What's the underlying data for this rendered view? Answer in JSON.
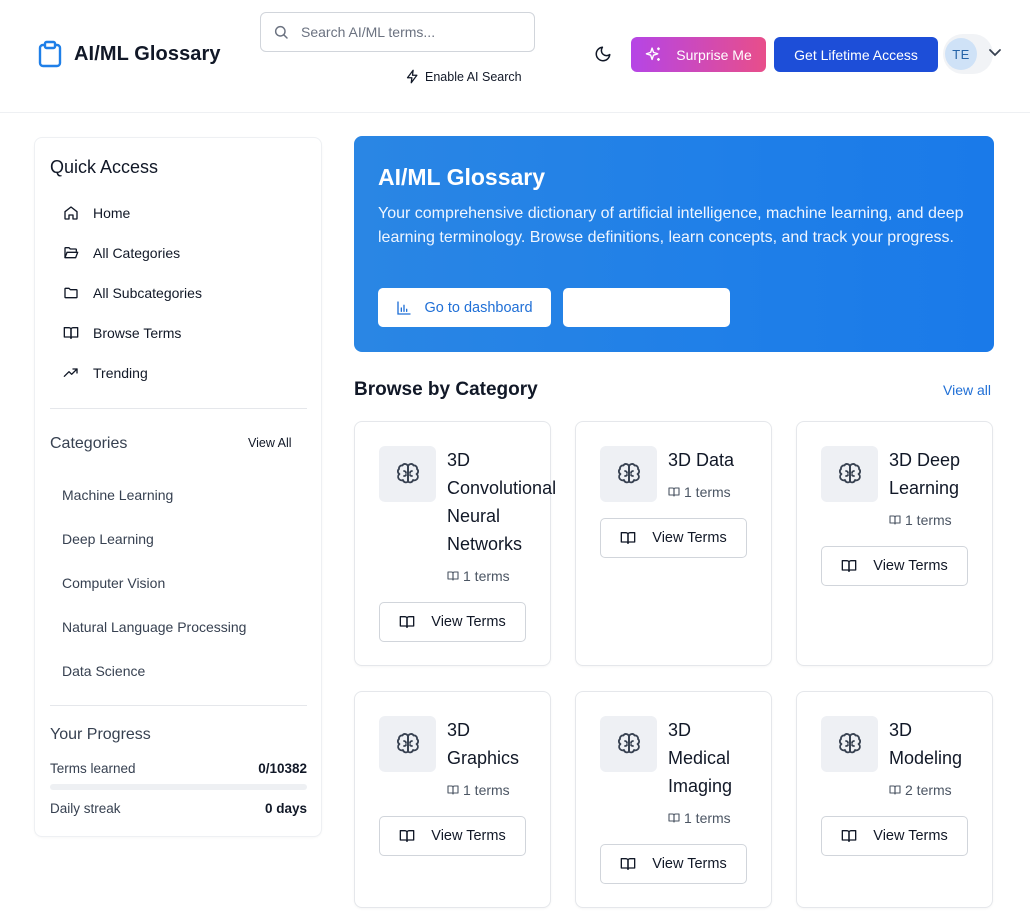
{
  "header": {
    "app_title": "AI/ML Glossary",
    "search_placeholder": "Search AI/ML terms...",
    "ai_search_label": "Enable AI Search",
    "surprise_label": "Surprise Me",
    "lifetime_label": "Get Lifetime Access",
    "avatar_initials": "TE"
  },
  "sidebar": {
    "quick_access_title": "Quick Access",
    "nav": [
      {
        "label": "Home",
        "icon": "home-icon"
      },
      {
        "label": "All Categories",
        "icon": "folder-open-icon"
      },
      {
        "label": "All Subcategories",
        "icon": "folder-icon"
      },
      {
        "label": "Browse Terms",
        "icon": "book-open-icon"
      },
      {
        "label": "Trending",
        "icon": "trending-up-icon"
      }
    ],
    "categories_title": "Categories",
    "categories_view_all": "View All",
    "categories": [
      "Machine Learning",
      "Deep Learning",
      "Computer Vision",
      "Natural Language Processing",
      "Data Science"
    ],
    "progress_title": "Your Progress",
    "terms_learned_label": "Terms learned",
    "terms_learned_value": "0/10382",
    "terms_learned_fraction": 0,
    "daily_streak_label": "Daily streak",
    "daily_streak_value": "0 days"
  },
  "hero": {
    "title": "AI/ML Glossary",
    "description": "Your comprehensive dictionary of artificial intelligence, machine learning, and deep learning terminology. Browse definitions, learn concepts, and track your progress.",
    "dashboard_label": "Go to dashboard",
    "secondary_label": ""
  },
  "browse": {
    "title": "Browse by Category",
    "view_all": "View all",
    "view_terms_label": "View Terms",
    "cards": [
      {
        "name": "3D Convolutional Neural Networks",
        "count": "1 terms"
      },
      {
        "name": "3D Data",
        "count": "1 terms"
      },
      {
        "name": "3D Deep Learning",
        "count": "1 terms"
      },
      {
        "name": "3D Graphics",
        "count": "1 terms"
      },
      {
        "name": "3D Medical Imaging",
        "count": "1 terms"
      },
      {
        "name": "3D Modeling",
        "count": "2 terms"
      }
    ]
  },
  "colors": {
    "accent": "#1d4ed8",
    "hero": "#2084e6",
    "surprise_start": "#b545e6",
    "surprise_end": "#e84e8a"
  }
}
